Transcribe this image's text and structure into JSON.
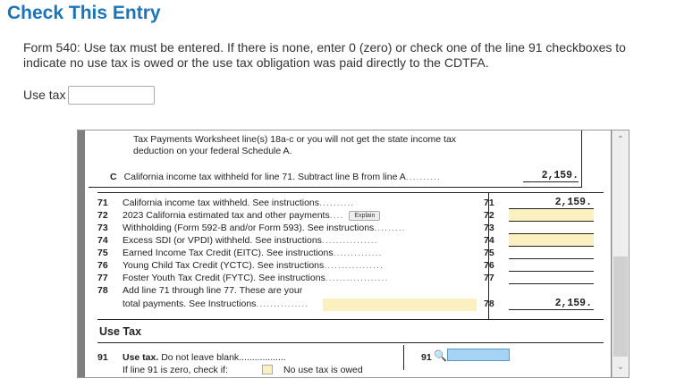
{
  "header": {
    "title": "Check This Entry"
  },
  "message": "Form 540: Use tax must be entered. If there is none, enter 0 (zero) or check one of the line 91 checkboxes to indicate no use tax is owed or the use tax obligation was paid directly to the CDTFA.",
  "use_tax_field": {
    "label": "Use tax",
    "value": ""
  },
  "worksheet": {
    "line1": "Tax Payments Worksheet line(s) 18a-c or you will not get the state income tax",
    "line2": "deduction on your federal Schedule A.",
    "c_label": "C",
    "c_text": "California income tax withheld for line 71. Subtract line B from line A",
    "c_value": "2,159."
  },
  "rows": [
    {
      "num": "71",
      "text": "California income tax withheld. See instructions",
      "ln": "71",
      "value": "2,159."
    },
    {
      "num": "72",
      "text": "2023 California estimated tax and other payments",
      "ln": "72",
      "value": "",
      "explain": "Explain"
    },
    {
      "num": "73",
      "text": "Withholding (Form 592-B and/or Form 593). See instructions",
      "ln": "73",
      "value": ""
    },
    {
      "num": "74",
      "text": "Excess SDI (or VPDI) withheld. See instructions",
      "ln": "74",
      "value": ""
    },
    {
      "num": "75",
      "text": "Earned Income Tax Credit (EITC). See instructions",
      "ln": "75",
      "value": ""
    },
    {
      "num": "76",
      "text": "Young Child Tax Credit (YCTC). See instructions",
      "ln": "76",
      "value": ""
    },
    {
      "num": "77",
      "text": "Foster Youth Tax Credit (FYTC). See instructions",
      "ln": "77",
      "value": ""
    },
    {
      "num": "78",
      "text": "Add line 71 through line 77. These are your",
      "text2": "total payments. See Instructions",
      "ln": "78",
      "value": "2,159."
    }
  ],
  "section": {
    "title": "Use Tax"
  },
  "line91": {
    "num": "91",
    "bold": "Use tax.",
    "text": "Do not leave blank",
    "sub": "If line 91 is zero, check if:",
    "checkbox_label": "No use tax is owed",
    "ln": "91"
  }
}
